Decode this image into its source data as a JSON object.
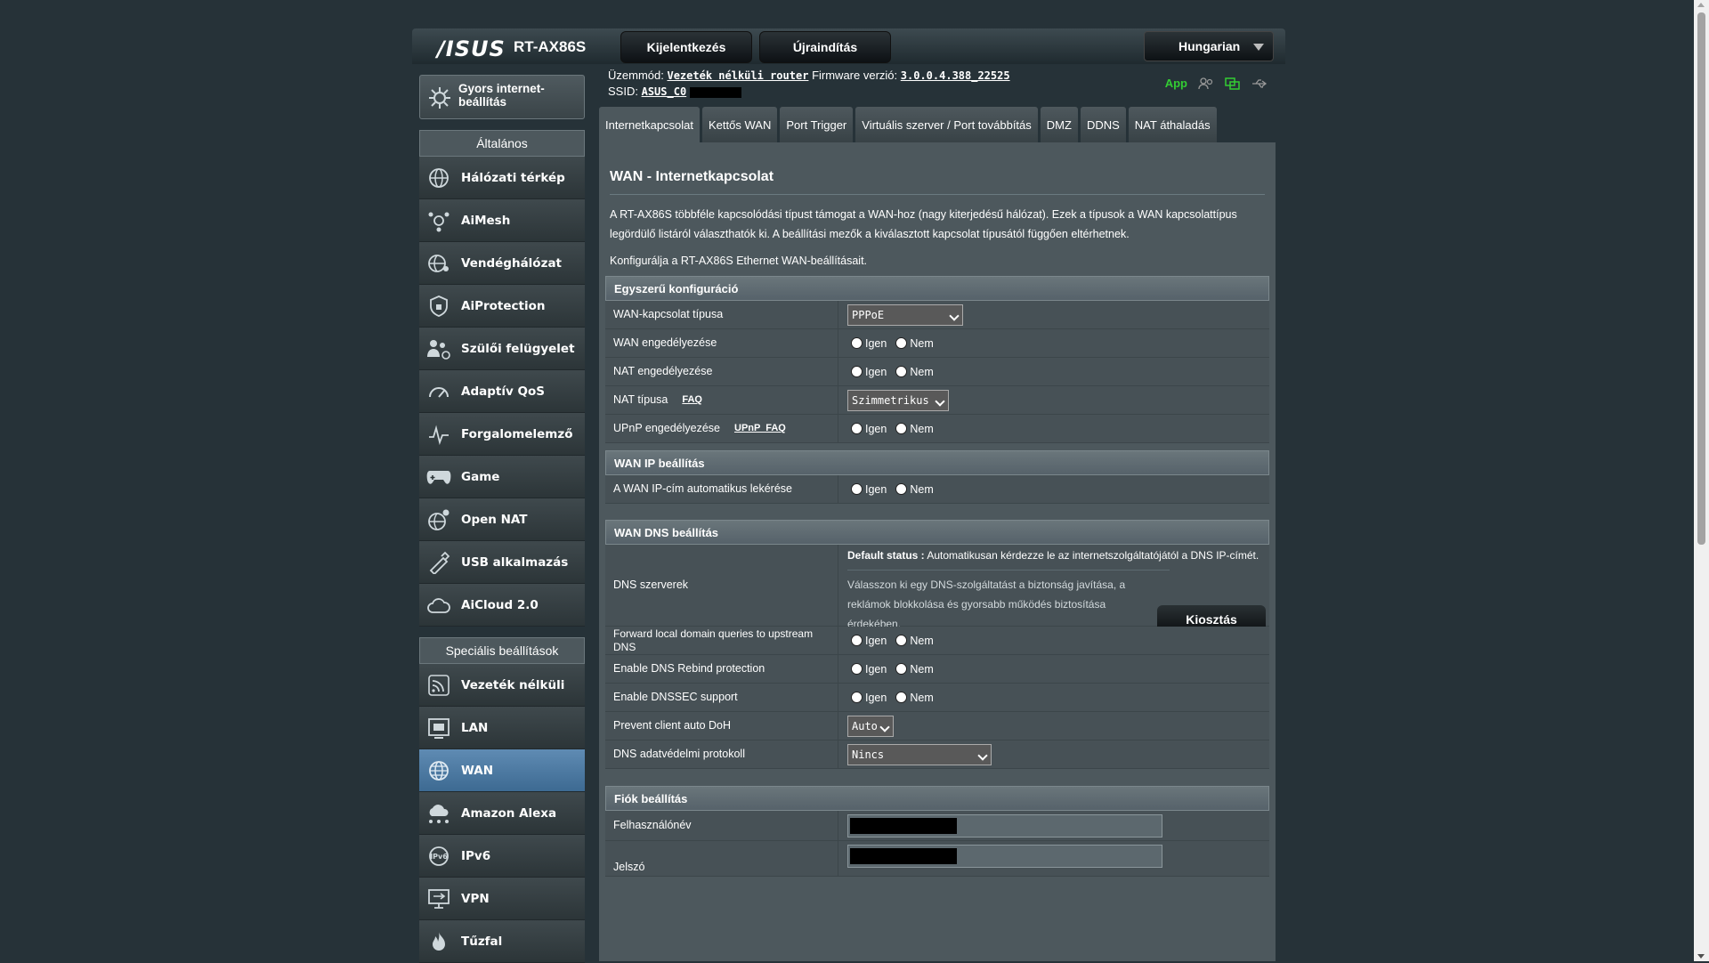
{
  "header": {
    "brand": "/ISUS",
    "model": "RT-AX86S",
    "logout": "Kijelentkezés",
    "reboot": "Újraindítás",
    "language": "Hungarian"
  },
  "status": {
    "mode_label": "Üzemmód:",
    "mode_value": "Vezeték nélküli router",
    "fw_label": "Firmware verzió:",
    "fw_value": "3.0.0.4.388_22525",
    "ssid_label": "SSID:",
    "ssid_value": "ASUS_C0",
    "app": "App"
  },
  "sidebar": {
    "qis": "Gyors internet-beállítás",
    "general": "Általános",
    "general_items": [
      "Hálózati térkép",
      "AiMesh",
      "Vendéghálózat",
      "AiProtection",
      "Szülői felügyelet",
      "Adaptív QoS",
      "Forgalomelemző",
      "Game",
      "Open NAT",
      "USB alkalmazás",
      "AiCloud 2.0"
    ],
    "advanced": "Speciális beállítások",
    "advanced_items": [
      "Vezeték nélküli",
      "LAN",
      "WAN",
      "Amazon Alexa",
      "IPv6",
      "VPN",
      "Tűzfal"
    ]
  },
  "tabs": [
    "Internetkapcsolat",
    "Kettős WAN",
    "Port Trigger",
    "Virtuális szerver / Port továbbítás",
    "DMZ",
    "DDNS",
    "NAT áthaladás"
  ],
  "content": {
    "title": "WAN - Internetkapcsolat",
    "description": "A RT-AX86S többféle kapcsolódási típust támogat a WAN-hoz (nagy kiterjedésű hálózat). Ezek a típusok a WAN kapcsolattípus legördülő listáról választhatók ki. A beállítási mezők a kiválasztott kapcsolat típusától függően eltérhetnek.",
    "description2": "Konfigurálja a RT-AX86S Ethernet WAN-beállításait.",
    "yes": "Igen",
    "no": "Nem",
    "basic": {
      "header": "Egyszerű konfiguráció",
      "wan_type_label": "WAN-kapcsolat típusa",
      "wan_type_value": "PPPoE",
      "wan_enable": "WAN engedélyezése",
      "nat_enable": "NAT engedélyezése",
      "nat_type": "NAT típusa",
      "faq": "FAQ",
      "nat_type_value": "Szimmetrikus",
      "upnp": "UPnP engedélyezése",
      "upnp_faq": "UPnP  FAQ"
    },
    "wanip": {
      "header": "WAN IP beállítás",
      "auto_ip": "A WAN IP-cím automatikus lekérése"
    },
    "dns": {
      "header": "WAN DNS beállítás",
      "servers": "DNS szerverek",
      "default_bold": "Default status :",
      "default_text": " Automatikusan kérdezze le az internetszolgáltatójától a DNS IP-címét.",
      "hint": "Válasszon ki egy DNS-szolgáltatást a biztonság javítása, a reklámok blokkolása és gyorsabb működés biztosítása érdekében.",
      "assign": "Kiosztás",
      "forward": "Forward local domain queries to upstream DNS",
      "rebind": "Enable DNS Rebind protection",
      "dnssec": "Enable DNSSEC support",
      "doh": "Prevent client auto DoH",
      "doh_value": "Auto",
      "privacy": "DNS adatvédelmi protokoll",
      "privacy_value": "Nincs"
    },
    "account": {
      "header": "Fiók beállítás",
      "username": "Felhasználónév",
      "password": "Jelszó"
    }
  }
}
